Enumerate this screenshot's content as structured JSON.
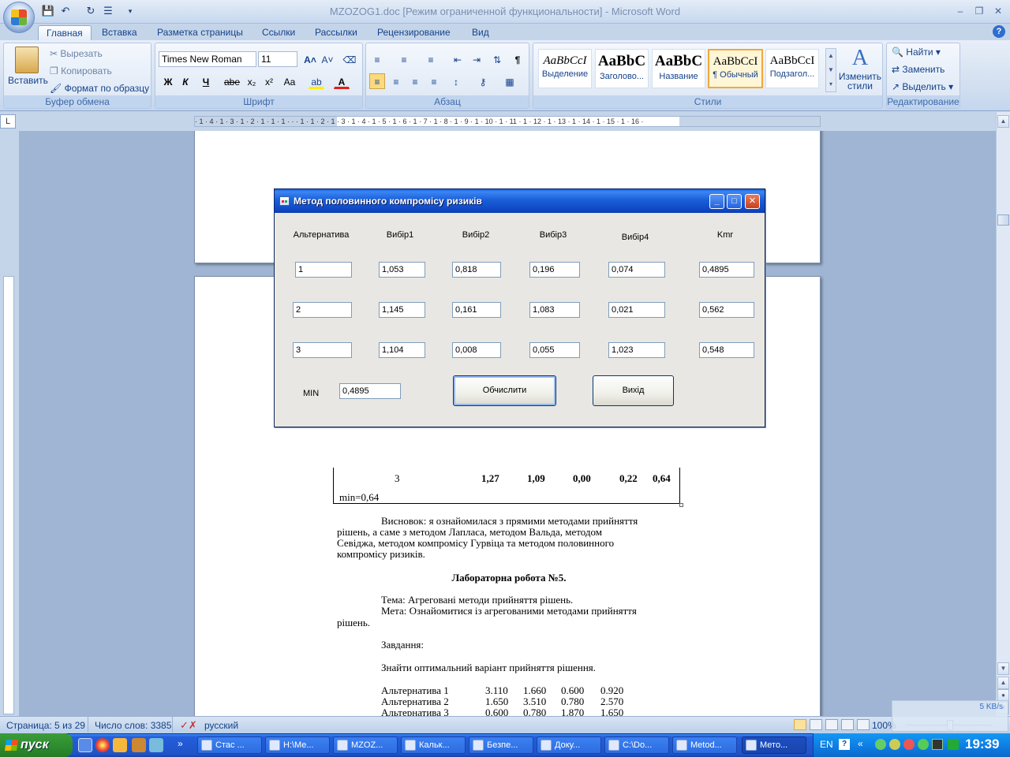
{
  "window": {
    "title": "MZOZOG1.doc [Режим ограниченной функциональности] - Microsoft Word"
  },
  "tabs": [
    "Главная",
    "Вставка",
    "Разметка страницы",
    "Ссылки",
    "Рассылки",
    "Рецензирование",
    "Вид"
  ],
  "ribbon": {
    "clipboard": {
      "paste": "Вставить",
      "cut": "Вырезать",
      "copy": "Копировать",
      "format_painter": "Формат по образцу",
      "label": "Буфер обмена"
    },
    "font": {
      "name": "Times New Roman",
      "size": "11",
      "label": "Шрифт",
      "bold": "Ж",
      "italic": "К",
      "underline": "Ч",
      "strike": "abe",
      "sub": "x₂",
      "sup": "x²",
      "case": "Aa"
    },
    "paragraph": {
      "label": "Абзац"
    },
    "styles": {
      "label": "Стили",
      "items": [
        {
          "sample": "AaBbCcI",
          "name": "Выделение"
        },
        {
          "sample": "AaBbC",
          "name": "Заголово..."
        },
        {
          "sample": "AaBbC",
          "name": "Название"
        },
        {
          "sample": "AaBbCcI",
          "name": "¶ Обычный"
        },
        {
          "sample": "AaBbCcI",
          "name": "Подзагол..."
        }
      ],
      "change": "Изменить стили"
    },
    "editing": {
      "find": "Найти",
      "replace": "Заменить",
      "select": "Выделить",
      "label": "Редактирование"
    }
  },
  "ruler": {
    "ticks": "· 1 · 4 · 1 · 3 · 1 · 2 · 1 · 1 · 1 · · · 1 · 1 · 2 · 1 · 3 · 1 · 4 · 1 · 5 · 1 · 6 · 1 · 7 · 1 · 8 · 1 · 9 · 1 · 10 · 1 · 11 · 1 · 12 · 1 · 13 · 1 · 14 · 1 · 15 · 1 · 16 ·"
  },
  "document": {
    "table_tail": {
      "row_label": "3",
      "values": [
        "1,27",
        "1,09",
        "0,00",
        "0,22",
        "0,64"
      ],
      "min_text": "min=0,64"
    },
    "paragraphs": {
      "conclusion_1": "Висновок: я ознайомилася з прямими  методами прийняття",
      "conclusion_2": "рішень, а саме з методом Лапласа, методом Вальда, методом",
      "conclusion_3": "Севіджа, методом компромісу Гурвіца та методом половинного",
      "conclusion_4": "компромісу ризиків.",
      "lab_title": "Лабораторна робота №5.",
      "topic": "Тема:  Агреговані методи прийняття рішень.",
      "goal_1": "Мета: Ознайомитися із агрегованими методами прийняття",
      "goal_2": "рішень.",
      "task": "Завдання:",
      "task_text": "Знайти оптимальний варіант прийняття рішення."
    },
    "alternatives": [
      {
        "name": "Альтернатива 1",
        "values": [
          "3.110",
          "1.660",
          "0.600",
          "0.920"
        ]
      },
      {
        "name": "Альтернатива 2",
        "values": [
          "1.650",
          "3.510",
          "0.780",
          "2.570"
        ]
      },
      {
        "name": "Альтернатива 3",
        "values": [
          "0.600",
          "0.780",
          "1.870",
          "1.650"
        ]
      }
    ]
  },
  "dialog": {
    "title": "Метод половинного компромісу ризиків",
    "headers": [
      "Альтернатива",
      "Вибір1",
      "Вибір2",
      "Вибір3",
      "Вибір4",
      "Kmr"
    ],
    "rows": [
      [
        "1",
        "1,053",
        "0,818",
        "0,196",
        "0,074",
        "0,4895"
      ],
      [
        "2",
        "1,145",
        "0,161",
        "1,083",
        "0,021",
        "0,562"
      ],
      [
        "3",
        "1,104",
        "0,008",
        "0,055",
        "1,023",
        "0,548"
      ]
    ],
    "min_label": "MIN",
    "min_value": "0,4895",
    "compute_button": "Обчислити",
    "exit_button": "Вихід"
  },
  "status": {
    "page": "Страница: 5 из 29",
    "words": "Число слов: 3385",
    "language": "русский",
    "zoom": "100%",
    "net_speed": "5 KB/s"
  },
  "taskbar": {
    "start": "пуск",
    "items": [
      "Стас ...",
      "H:\\Me...",
      "MZOZ...",
      "Кальк...",
      "Безпе...",
      "Доку...",
      "C:\\Do...",
      "Metod...",
      "Мето..."
    ],
    "lang": "EN",
    "clock": "19:39"
  },
  "colors": {
    "accent": "#15428b",
    "title_blue": "#0a5fe0",
    "taskbar_blue": "#245edb",
    "start_green": "#2f8f2f"
  }
}
